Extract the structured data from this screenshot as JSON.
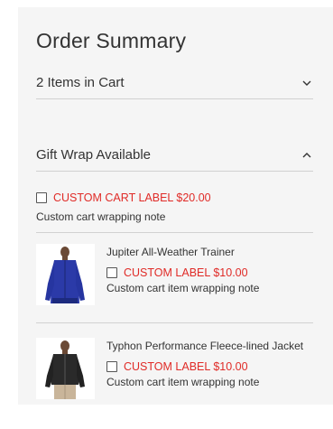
{
  "summary": {
    "title": "Order Summary",
    "items_in_cart": "2 Items in Cart"
  },
  "gift_wrap": {
    "header": "Gift Wrap Available",
    "cart": {
      "label": "CUSTOM CART LABEL $20.00",
      "note": "Custom cart wrapping note"
    },
    "items": [
      {
        "name": "Jupiter All-Weather Trainer",
        "label": "CUSTOM LABEL $10.00",
        "note": "Custom cart item wrapping note"
      },
      {
        "name": "Typhon Performance Fleece-lined Jacket",
        "label": "CUSTOM LABEL $10.00",
        "note": "Custom cart item wrapping note"
      }
    ]
  },
  "colors": {
    "panel_bg": "#f5f5f5",
    "accent_red": "#e02b27",
    "divider": "#d1d1d1"
  },
  "icons": {
    "items_toggle": "chevron-down-icon",
    "gift_toggle": "chevron-up-icon"
  }
}
